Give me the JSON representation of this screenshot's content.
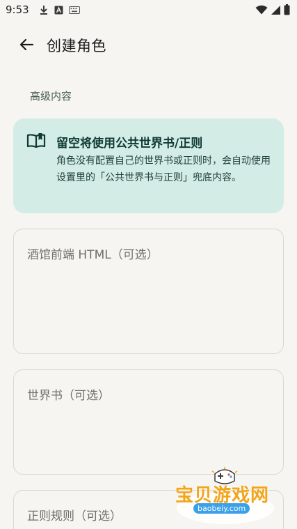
{
  "status_bar": {
    "time": "9:53",
    "icons": [
      "download-icon",
      "a-box-icon",
      "keyboard-icon",
      "wifi-icon",
      "signal-icon",
      "battery-icon"
    ]
  },
  "app_bar": {
    "back_icon": "arrow-left-icon",
    "title": "创建角色"
  },
  "section": {
    "label": "高级内容"
  },
  "info_card": {
    "icon": "open-book-icon",
    "title": "留空将使用公共世界书/正则",
    "body": "角色没有配置自己的世界书或正则时，会自动使用设置里的「公共世界书与正则」兜底内容。"
  },
  "fields": {
    "html_placeholder": "酒馆前端 HTML（可选）",
    "world_book_placeholder": "世界书（可选）",
    "regex_placeholder": "正则规则（可选）"
  },
  "watermark": {
    "text": "宝贝游戏网",
    "domain": "baobeiy.com"
  },
  "colors": {
    "background": "#f6f5f1",
    "card_background": "#d3ece6",
    "card_title": "#0e3a33",
    "field_border": "#d6d8d2",
    "watermark_orange": "#f2a51a"
  }
}
